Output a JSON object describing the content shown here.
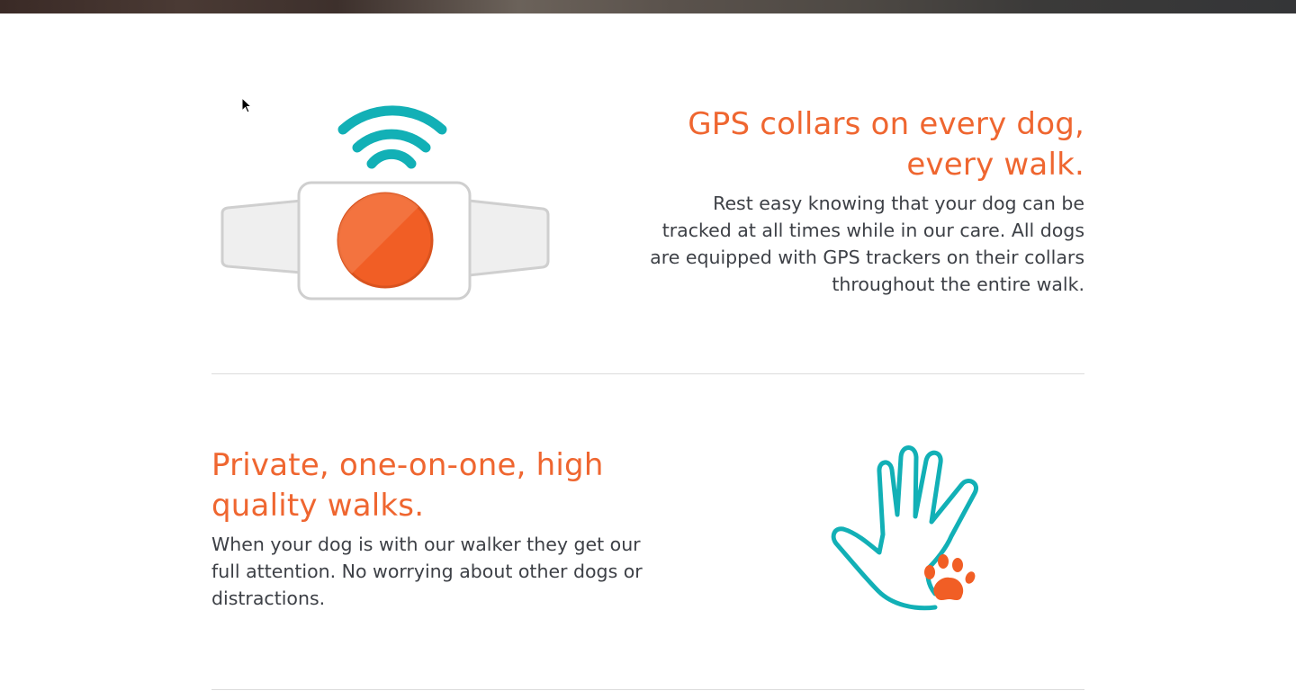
{
  "features": [
    {
      "title_line1": "GPS collars on every dog,",
      "title_line2": "every walk.",
      "body_lines": [
        "Rest easy knowing that your dog can be",
        "tracked at all times while in our care. All dogs",
        "are equipped with GPS trackers on their collars",
        "throughout the entire walk."
      ],
      "icon": "gps-collar-icon"
    },
    {
      "title_line1": "Private, one-on-one, high",
      "title_line2": "quality walks.",
      "body_lines": [
        "When your dog is with our walker they get our",
        "full attention. No worrying about other dogs or",
        "distractions."
      ],
      "icon": "hand-paw-icon"
    }
  ],
  "colors": {
    "accent_orange": "#ef6630",
    "accent_teal": "#12b0b6",
    "body_text": "#3d4046",
    "divider": "#dcdcdc"
  }
}
